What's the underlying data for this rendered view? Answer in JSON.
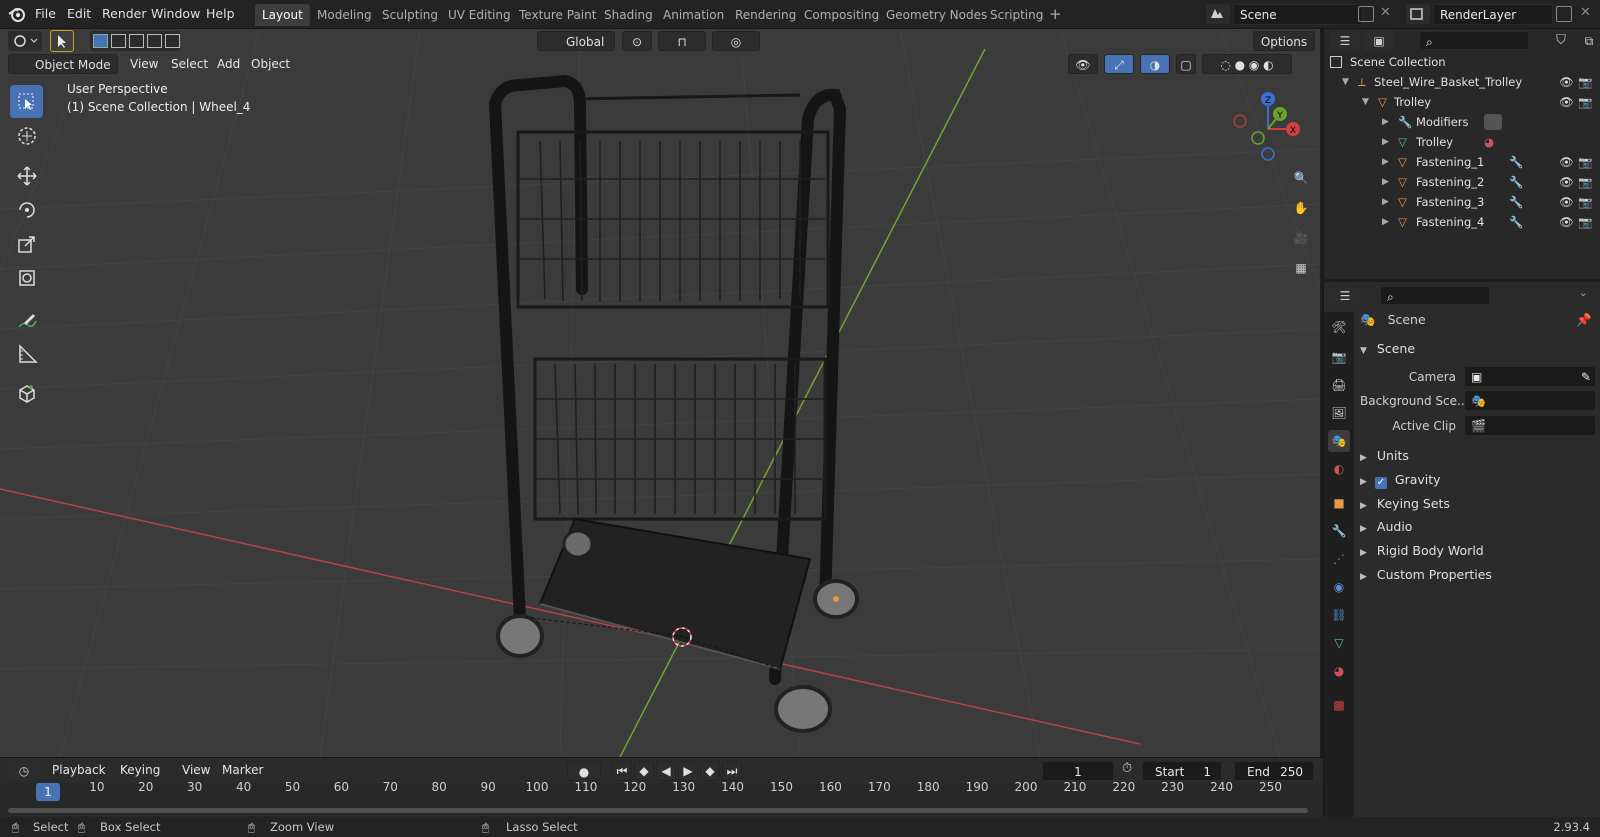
{
  "menus": [
    "File",
    "Edit",
    "Render",
    "Window",
    "Help"
  ],
  "workspaces": [
    "Layout",
    "Modeling",
    "Sculpting",
    "UV Editing",
    "Texture Paint",
    "Shading",
    "Animation",
    "Rendering",
    "Compositing",
    "Geometry Nodes",
    "Scripting"
  ],
  "active_workspace": "Layout",
  "scene_name": "Scene",
  "view_layer": "RenderLayer",
  "header": {
    "transform_orientation": "Global",
    "options_label": "Options",
    "mode": "Object Mode",
    "view_menu": "View",
    "select_menu": "Select",
    "add_menu": "Add",
    "object_menu": "Object"
  },
  "viewport": {
    "perspective": "User Perspective",
    "context": "(1) Scene Collection | Wheel_4",
    "gizmo": {
      "x": "X",
      "y": "Y",
      "z": "Z"
    }
  },
  "outliner": {
    "root": "Scene Collection",
    "rows": [
      {
        "label": "Steel_Wire_Basket_Trolley",
        "depth": 1,
        "icon": "empty-icon"
      },
      {
        "label": "Trolley",
        "depth": 2,
        "icon": "mesh-object-icon"
      },
      {
        "label": "Modifiers",
        "depth": 3,
        "icon": "wrench-icon"
      },
      {
        "label": "Trolley",
        "depth": 3,
        "icon": "mesh-data-icon"
      },
      {
        "label": "Fastening_1",
        "depth": 3,
        "icon": "mesh-object-icon"
      },
      {
        "label": "Fastening_2",
        "depth": 3,
        "icon": "mesh-object-icon"
      },
      {
        "label": "Fastening_3",
        "depth": 3,
        "icon": "mesh-object-icon"
      },
      {
        "label": "Fastening_4",
        "depth": 3,
        "icon": "mesh-object-icon"
      }
    ]
  },
  "properties": {
    "context_title": "Scene",
    "panel_title": "Scene",
    "fields": [
      {
        "label": "Camera",
        "value": ""
      },
      {
        "label": "Background Sce...",
        "value": ""
      },
      {
        "label": "Active Clip",
        "value": ""
      }
    ],
    "subpanels": [
      "Units",
      "Gravity",
      "Keying Sets",
      "Audio",
      "Rigid Body World",
      "Custom Properties"
    ],
    "gravity_checked": true
  },
  "timeline": {
    "menus": [
      "Playback",
      "Keying",
      "View",
      "Marker"
    ],
    "current_frame": "1",
    "start_label": "Start",
    "start": "1",
    "end_label": "End",
    "end": "250",
    "ticks": [
      "1",
      "10",
      "20",
      "30",
      "40",
      "50",
      "60",
      "70",
      "80",
      "90",
      "100",
      "110",
      "120",
      "130",
      "140",
      "150",
      "160",
      "170",
      "180",
      "190",
      "200",
      "210",
      "220",
      "230",
      "240",
      "250"
    ]
  },
  "statusbar": {
    "select": "Select",
    "box_select": "Box Select",
    "zoom_view": "Zoom View",
    "lasso_select": "Lasso Select",
    "version": "2.93.4"
  },
  "colors": {
    "accent": "#4772b3",
    "axis_x": "#c44a4a",
    "axis_y": "#6e9e2a",
    "object_orange": "#e8964a"
  }
}
